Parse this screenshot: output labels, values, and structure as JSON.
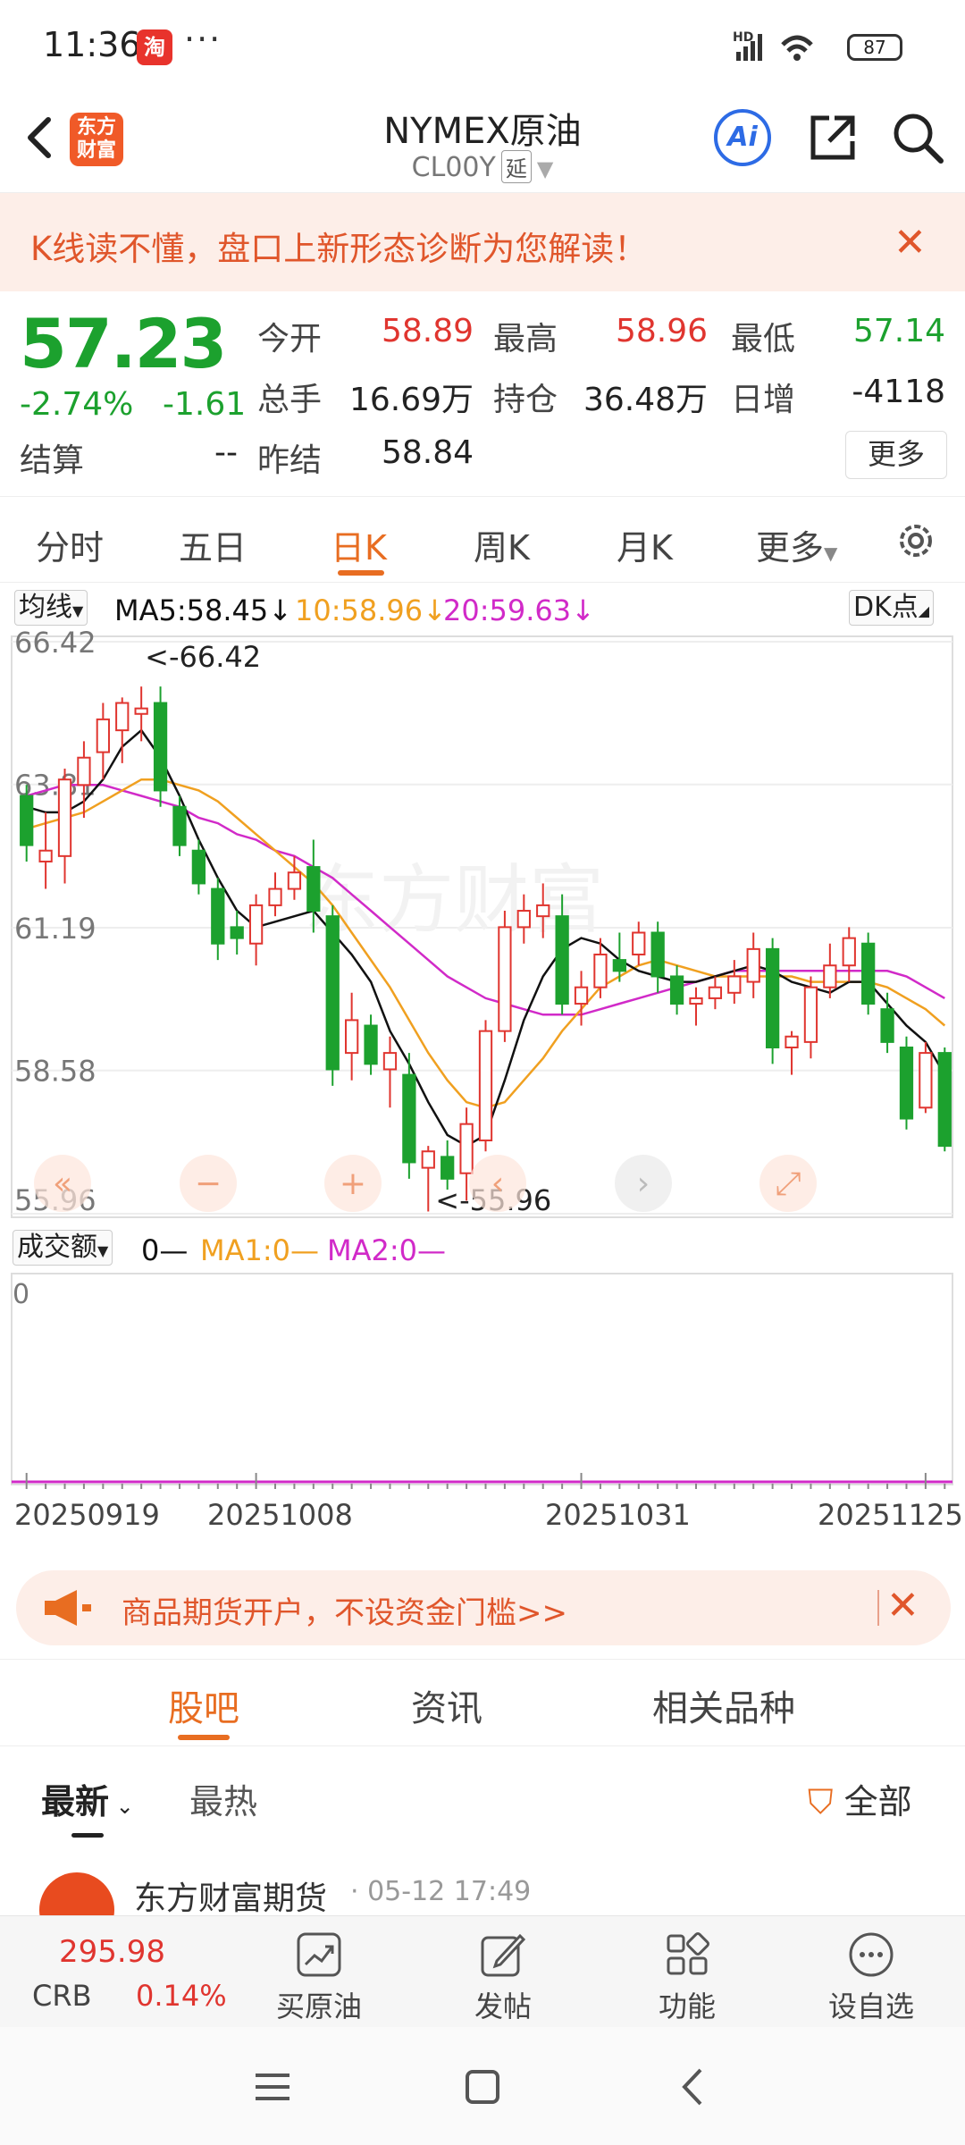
{
  "status_bar": {
    "time": "11:36",
    "app_badge": "淘",
    "overflow": "···",
    "signal": "HD",
    "battery": "87"
  },
  "header": {
    "title": "NYMEX原油",
    "code": "CL00Y",
    "delay_tag": "延",
    "logo_text": "东方财富",
    "ai_label": "Ai"
  },
  "banner": {
    "text": "K线读不懂，盘口上新形态诊断为您解读！"
  },
  "quote": {
    "price": "57.23",
    "change_pct": "-2.74%",
    "change_abs": "-1.61",
    "settle_label": "结算",
    "settle_value": "--",
    "open_label": "今开",
    "open_value": "58.89",
    "high_label": "最高",
    "high_value": "58.96",
    "low_label": "最低",
    "low_value": "57.14",
    "volume_label": "总手",
    "volume_value": "16.69万",
    "oi_label": "持仓",
    "oi_value": "36.48万",
    "daily_inc_label": "日增",
    "daily_inc_value": "-4118",
    "prev_settle_label": "昨结",
    "prev_settle_value": "58.84",
    "more_label": "更多"
  },
  "kline_tabs": [
    "分时",
    "五日",
    "日K",
    "周K",
    "月K",
    "更多"
  ],
  "active_kline_tab": "日K",
  "ma_legend": {
    "selector": "均线",
    "ma5": "MA5:58.45↓",
    "ma10": "10:58.96↓",
    "ma20": "20:59.63↓",
    "dk": "DK点"
  },
  "colors": {
    "up": "#e0352f",
    "down": "#1ca12e",
    "ma5": "#111111",
    "ma10": "#f0a020",
    "ma20": "#d12ac8",
    "accent": "#e86d21"
  },
  "chart_data": {
    "type": "candlestick",
    "y_ticks": [
      "66.42",
      "63.81",
      "61.19",
      "58.58",
      "55.96"
    ],
    "ylim": [
      55.96,
      66.42
    ],
    "max_label": "<-66.42",
    "min_label": "<-55.96",
    "x_ticks": [
      "20250919",
      "20251008",
      "20251031",
      "20251125"
    ],
    "candles": [
      [
        63.6,
        63.8,
        62.4,
        62.7
      ],
      [
        62.4,
        63.3,
        61.9,
        62.6
      ],
      [
        62.5,
        64.1,
        62.0,
        63.9
      ],
      [
        63.8,
        64.6,
        63.2,
        64.3
      ],
      [
        64.4,
        65.3,
        63.9,
        65.0
      ],
      [
        64.8,
        65.4,
        64.2,
        65.3
      ],
      [
        65.1,
        65.6,
        64.6,
        65.2
      ],
      [
        65.3,
        65.6,
        63.4,
        63.7
      ],
      [
        63.4,
        63.6,
        62.5,
        62.7
      ],
      [
        62.6,
        62.8,
        61.8,
        62.0
      ],
      [
        61.9,
        62.1,
        60.6,
        60.9
      ],
      [
        61.2,
        61.5,
        60.7,
        61.0
      ],
      [
        60.9,
        61.8,
        60.5,
        61.6
      ],
      [
        61.6,
        62.2,
        61.4,
        61.9
      ],
      [
        61.9,
        62.5,
        61.7,
        62.2
      ],
      [
        62.3,
        62.8,
        61.1,
        61.5
      ],
      [
        61.4,
        61.6,
        58.3,
        58.6
      ],
      [
        58.9,
        60.0,
        58.4,
        59.5
      ],
      [
        59.4,
        59.6,
        58.5,
        58.7
      ],
      [
        58.6,
        59.2,
        57.9,
        58.9
      ],
      [
        58.5,
        58.9,
        56.6,
        56.9
      ],
      [
        56.8,
        57.2,
        56.0,
        57.1
      ],
      [
        57.0,
        57.3,
        56.4,
        56.6
      ],
      [
        56.7,
        57.9,
        56.2,
        57.6
      ],
      [
        57.3,
        59.5,
        57.1,
        59.3
      ],
      [
        59.3,
        61.5,
        59.1,
        61.2
      ],
      [
        61.2,
        61.8,
        60.9,
        61.5
      ],
      [
        61.4,
        62.0,
        61.0,
        61.6
      ],
      [
        61.4,
        61.8,
        59.6,
        59.8
      ],
      [
        59.8,
        60.4,
        59.4,
        60.1
      ],
      [
        60.1,
        61.0,
        59.9,
        60.7
      ],
      [
        60.6,
        61.1,
        60.2,
        60.4
      ],
      [
        60.7,
        61.3,
        60.5,
        61.1
      ],
      [
        61.1,
        61.3,
        60.0,
        60.3
      ],
      [
        60.3,
        60.5,
        59.6,
        59.8
      ],
      [
        59.8,
        60.1,
        59.4,
        59.9
      ],
      [
        59.9,
        60.3,
        59.7,
        60.1
      ],
      [
        60.0,
        60.6,
        59.8,
        60.3
      ],
      [
        60.2,
        61.1,
        59.9,
        60.8
      ],
      [
        60.8,
        61.0,
        58.7,
        59.0
      ],
      [
        59.0,
        59.3,
        58.5,
        59.2
      ],
      [
        59.1,
        60.3,
        58.8,
        60.1
      ],
      [
        60.1,
        60.9,
        59.9,
        60.5
      ],
      [
        60.5,
        61.2,
        60.2,
        61.0
      ],
      [
        60.9,
        61.1,
        59.6,
        59.8
      ],
      [
        59.7,
        60.0,
        58.9,
        59.1
      ],
      [
        59.0,
        59.2,
        57.5,
        57.7
      ],
      [
        57.9,
        59.1,
        57.8,
        58.9
      ],
      [
        58.9,
        59.0,
        57.1,
        57.2
      ]
    ],
    "ma5": [
      63.4,
      63.3,
      63.3,
      63.5,
      63.9,
      64.5,
      64.8,
      64.3,
      63.6,
      62.8,
      62.1,
      61.5,
      61.2,
      61.3,
      61.4,
      61.5,
      61.1,
      60.7,
      60.2,
      59.3,
      58.7,
      58.0,
      57.4,
      57.2,
      57.4,
      58.4,
      59.5,
      60.3,
      60.8,
      61.0,
      60.9,
      60.6,
      60.4,
      60.3,
      60.2,
      60.2,
      60.3,
      60.4,
      60.5,
      60.4,
      60.2,
      60.1,
      60.0,
      60.2,
      60.2,
      59.8,
      59.4,
      59.1,
      58.5
    ],
    "ma10": [
      63.0,
      63.1,
      63.2,
      63.3,
      63.5,
      63.7,
      63.9,
      63.9,
      63.8,
      63.7,
      63.5,
      63.2,
      62.9,
      62.6,
      62.3,
      62.0,
      61.6,
      61.1,
      60.6,
      60.1,
      59.5,
      58.9,
      58.4,
      58.0,
      57.9,
      58.0,
      58.4,
      58.8,
      59.3,
      59.7,
      60.1,
      60.3,
      60.5,
      60.6,
      60.5,
      60.4,
      60.3,
      60.3,
      60.3,
      60.3,
      60.3,
      60.2,
      60.2,
      60.2,
      60.2,
      60.1,
      59.9,
      59.7,
      59.4
    ],
    "ma20": [
      63.6,
      63.7,
      63.8,
      63.8,
      63.8,
      63.7,
      63.6,
      63.5,
      63.4,
      63.2,
      63.1,
      62.9,
      62.8,
      62.6,
      62.5,
      62.3,
      62.1,
      61.8,
      61.5,
      61.2,
      60.9,
      60.6,
      60.3,
      60.1,
      59.9,
      59.8,
      59.7,
      59.6,
      59.6,
      59.6,
      59.7,
      59.8,
      59.9,
      60.0,
      60.1,
      60.2,
      60.3,
      60.4,
      60.4,
      60.4,
      60.4,
      60.4,
      60.4,
      60.4,
      60.4,
      60.4,
      60.3,
      60.1,
      59.9
    ]
  },
  "chart_controls": [
    "«",
    "−",
    "+",
    "‹",
    "›",
    "⤢"
  ],
  "volume": {
    "selector": "成交额",
    "value": "0—",
    "ma1": "MA1:0—",
    "ma2": "MA2:0—",
    "y_label": "0"
  },
  "ad": {
    "text": "商品期货开户，不设资金门槛>>"
  },
  "social_tabs": [
    "股吧",
    "资讯",
    "相关品种"
  ],
  "active_social_tab": "股吧",
  "sort": {
    "latest": "最新",
    "hot": "最热",
    "filter": "全部"
  },
  "post_preview": {
    "author": "东方财富期货",
    "time": "05-12 17:49"
  },
  "bottom_bar": {
    "index_value": "295.98",
    "index_name": "CRB",
    "index_change": "0.14%",
    "items": [
      "买原油",
      "发帖",
      "功能",
      "设自选"
    ]
  }
}
